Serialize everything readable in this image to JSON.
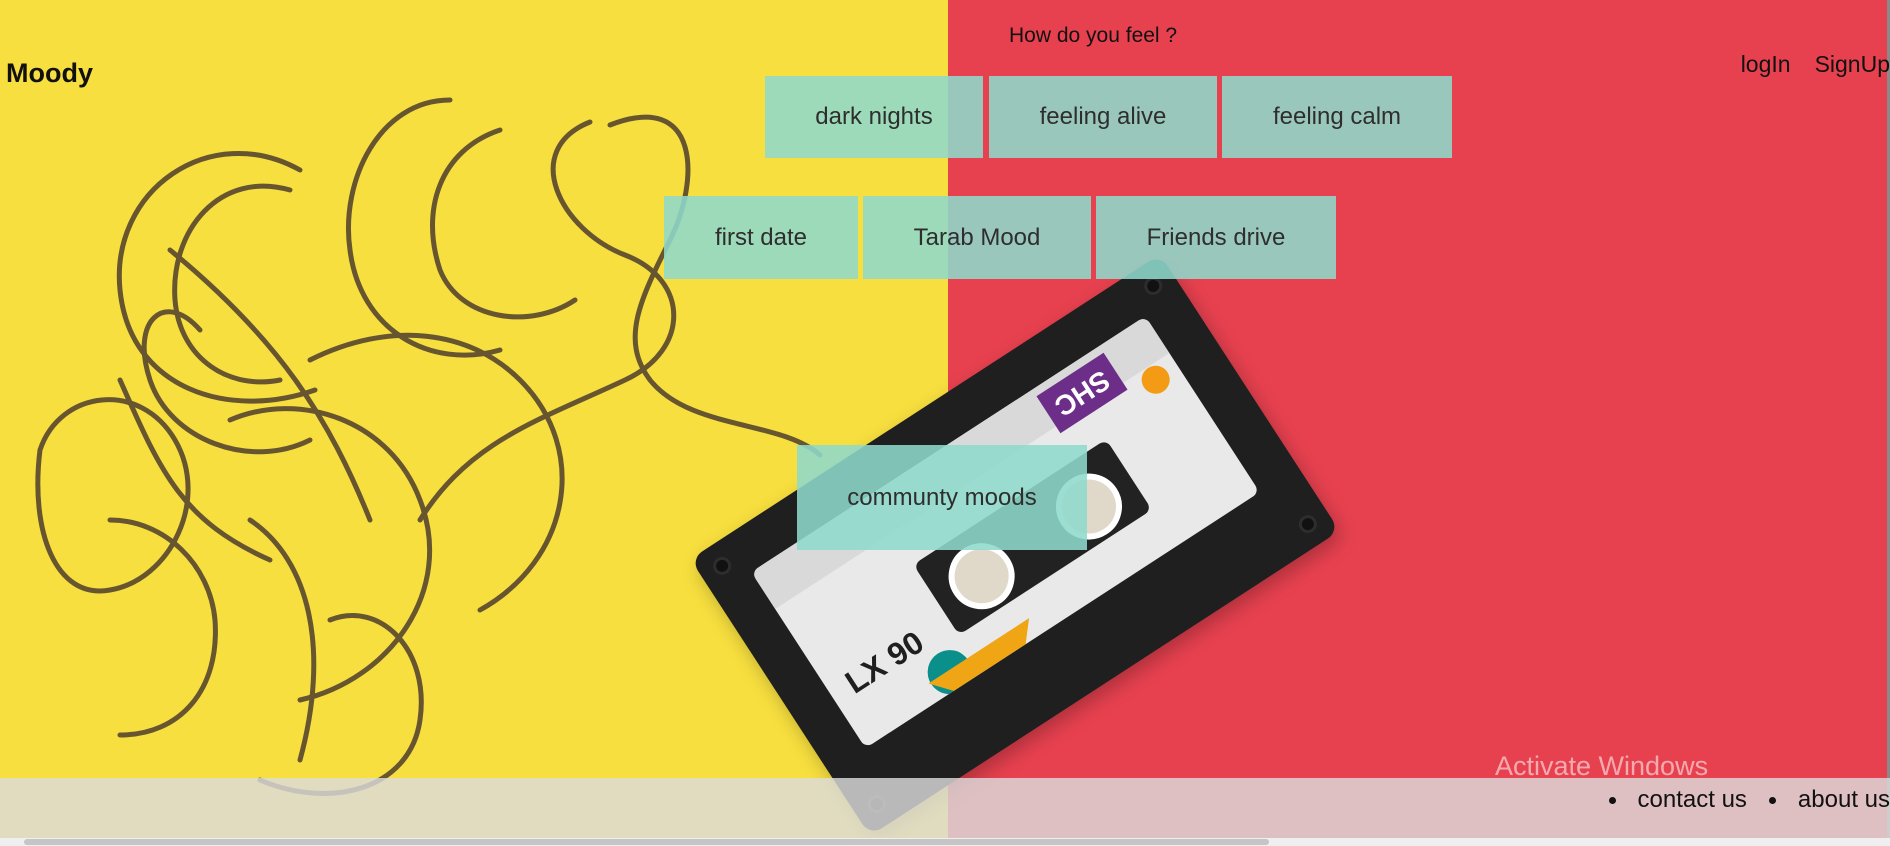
{
  "header": {
    "logo": "Moody",
    "prompt": "How do you feel ?",
    "login_label": "logIn",
    "signup_label": "SignUp"
  },
  "moods": {
    "row1": [
      "dark nights",
      "feeling alive",
      "feeling calm"
    ],
    "row2": [
      "first date",
      "Tarab Mood",
      "Friends drive"
    ],
    "community_label": "communty moods"
  },
  "footer": {
    "contact_label": "contact us",
    "about_label": "about us"
  },
  "watermark": {
    "title": "Activate Windows",
    "subtitle": ""
  },
  "visual": {
    "background_left": "#f7df3f",
    "background_right": "#e7414f",
    "cassette_brand": "SHC",
    "cassette_model": "LX 90"
  },
  "icons": {
    "tape": "tape-icon",
    "cassette": "cassette-icon"
  }
}
